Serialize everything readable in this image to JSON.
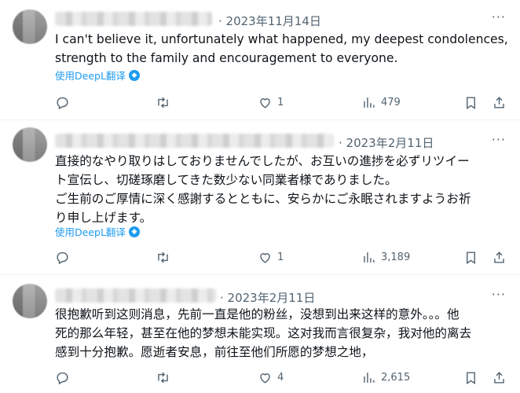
{
  "tweets": [
    {
      "date": "· 2023年11月14日",
      "lines": [
        "I can't believe it, unfortunately what happened, my deepest condolences,",
        "strength to the family and encouragement to everyone."
      ],
      "translate_label": "使用DeepL翻译",
      "replies": "",
      "reposts": "",
      "likes": "1",
      "views": "479"
    },
    {
      "date": "· 2023年2月11日",
      "lines": [
        "直接的なやり取りはしておりませんでしたが、お互いの進捗を必ずリツイー",
        "ト宣伝し、切磋琢磨してきた数少ない同業者様でありました。",
        "ご生前のご厚情に深く感謝するとともに、安らかにご永眠されますようお祈",
        "り申し上げます。"
      ],
      "translate_label": "使用DeepL翻译",
      "replies": "",
      "reposts": "",
      "likes": "1",
      "views": "3,189"
    },
    {
      "date": "· 2023年2月11日",
      "lines": [
        "很抱歉听到这则消息，先前一直是他的粉丝，没想到出来这样的意外。。。他",
        "死的那么年轻，甚至在他的梦想未能实现。这对我而言很复杂，我对他的离去",
        "感到十分抱歉。愿逝者安息，前往至他们所愿的梦想之地，"
      ],
      "replies": "",
      "reposts": "",
      "likes": "4",
      "views": "2,615"
    }
  ],
  "icons": {
    "reply": "reply-icon",
    "repost": "repost-icon",
    "like": "heart-icon",
    "views": "views-icon",
    "bookmark": "bookmark-icon",
    "share": "share-icon",
    "more": "more-icon",
    "translate": "deepl-icon"
  },
  "colors": {
    "accent": "#1d9bf0",
    "secondary_text": "#536471",
    "divider": "#eff3f4"
  }
}
